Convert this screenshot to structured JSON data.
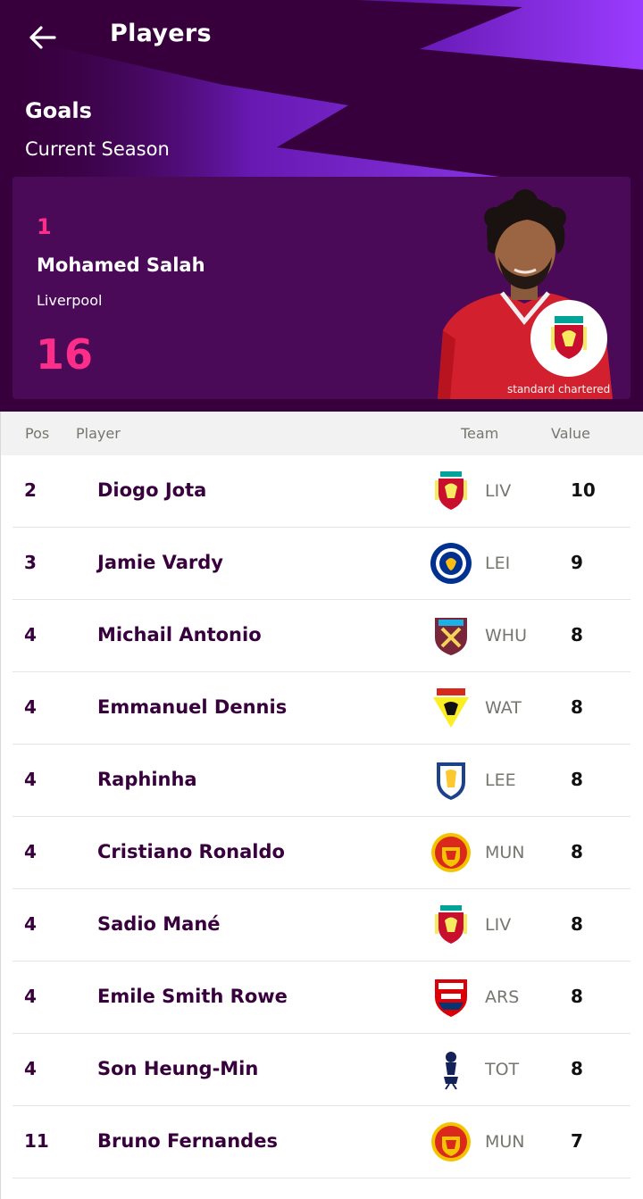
{
  "header": {
    "title": "Players",
    "stat_title": "Goals",
    "stat_subtitle": "Current Season"
  },
  "leader": {
    "rank": "1",
    "name": "Mohamed Salah",
    "team": "Liverpool",
    "value": "16",
    "shirt_sponsor": "standard chartered"
  },
  "table": {
    "headers": {
      "pos": "Pos",
      "player": "Player",
      "team": "Team",
      "value": "Value"
    },
    "rows": [
      {
        "pos": "2",
        "name": "Diogo Jota",
        "code": "LIV",
        "value": "10",
        "crest": "liverpool-crest"
      },
      {
        "pos": "3",
        "name": "Jamie Vardy",
        "code": "LEI",
        "value": "9",
        "crest": "leicester-crest"
      },
      {
        "pos": "4",
        "name": "Michail Antonio",
        "code": "WHU",
        "value": "8",
        "crest": "westham-crest"
      },
      {
        "pos": "4",
        "name": "Emmanuel Dennis",
        "code": "WAT",
        "value": "8",
        "crest": "watford-crest"
      },
      {
        "pos": "4",
        "name": "Raphinha",
        "code": "LEE",
        "value": "8",
        "crest": "leeds-crest"
      },
      {
        "pos": "4",
        "name": "Cristiano Ronaldo",
        "code": "MUN",
        "value": "8",
        "crest": "manutd-crest"
      },
      {
        "pos": "4",
        "name": "Sadio Mané",
        "code": "LIV",
        "value": "8",
        "crest": "liverpool-crest"
      },
      {
        "pos": "4",
        "name": "Emile Smith Rowe",
        "code": "ARS",
        "value": "8",
        "crest": "arsenal-crest"
      },
      {
        "pos": "4",
        "name": "Son Heung-Min",
        "code": "TOT",
        "value": "8",
        "crest": "tottenham-crest"
      },
      {
        "pos": "11",
        "name": "Bruno Fernandes",
        "code": "MUN",
        "value": "7",
        "crest": "manutd-crest"
      }
    ]
  },
  "colors": {
    "primary": "#37003c",
    "card": "#4b0a58",
    "accent_pink": "#ff2d8a",
    "accent_purple": "#963cff",
    "muted_text": "#76766f"
  }
}
